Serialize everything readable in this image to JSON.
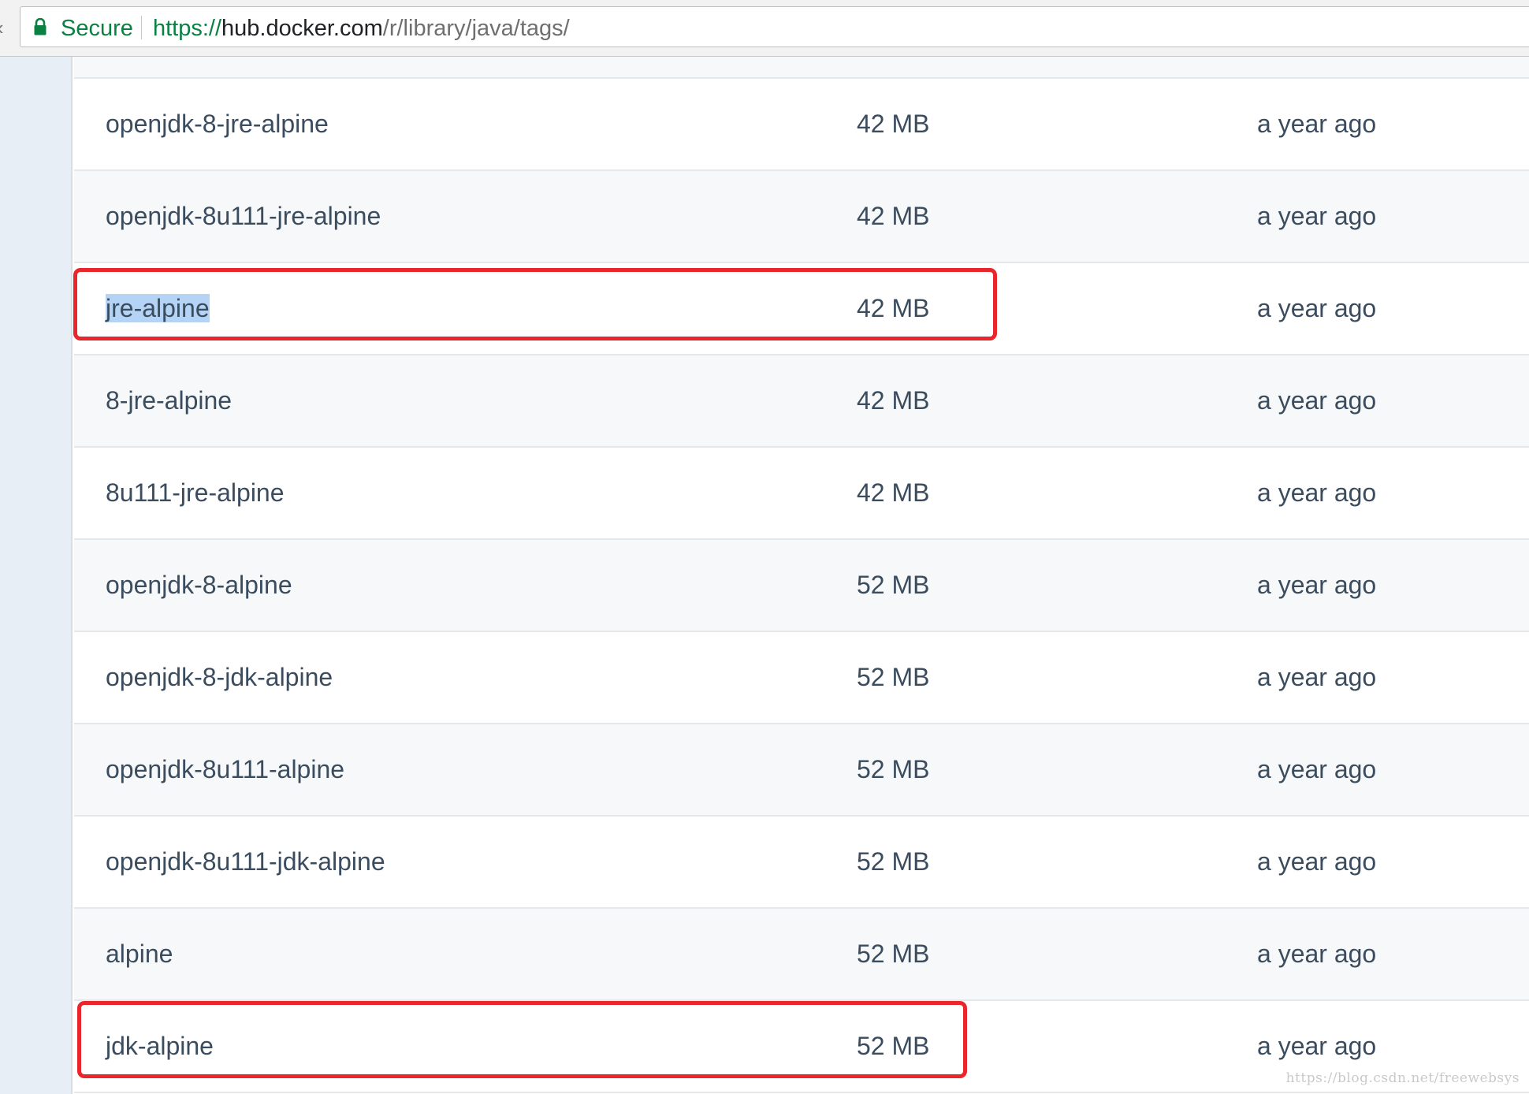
{
  "browser": {
    "secure_label": "Secure",
    "url_scheme": "https://",
    "url_host": "hub.docker.com",
    "url_path": "/r/library/java/tags/"
  },
  "tags": [
    {
      "name": "openjdk-8-jre-alpine",
      "size": "42 MB",
      "updated": "a year ago"
    },
    {
      "name": "openjdk-8u111-jre-alpine",
      "size": "42 MB",
      "updated": "a year ago"
    },
    {
      "name": "jre-alpine",
      "size": "42 MB",
      "updated": "a year ago"
    },
    {
      "name": "8-jre-alpine",
      "size": "42 MB",
      "updated": "a year ago"
    },
    {
      "name": "8u111-jre-alpine",
      "size": "42 MB",
      "updated": "a year ago"
    },
    {
      "name": "openjdk-8-alpine",
      "size": "52 MB",
      "updated": "a year ago"
    },
    {
      "name": "openjdk-8-jdk-alpine",
      "size": "52 MB",
      "updated": "a year ago"
    },
    {
      "name": "openjdk-8u111-alpine",
      "size": "52 MB",
      "updated": "a year ago"
    },
    {
      "name": "openjdk-8u111-jdk-alpine",
      "size": "52 MB",
      "updated": "a year ago"
    },
    {
      "name": "alpine",
      "size": "52 MB",
      "updated": "a year ago"
    },
    {
      "name": "jdk-alpine",
      "size": "52 MB",
      "updated": "a year ago"
    }
  ],
  "highlighted_tags": [
    "jre-alpine",
    "jdk-alpine"
  ],
  "selected_text": "jre-alpine",
  "colors": {
    "secure_green": "#0b8043",
    "annotation_red": "#e8262b",
    "selection_blue": "#b4d3f5",
    "row_text": "#3a4c5e"
  },
  "icons": {
    "lock": "lock-icon",
    "back": "back-arrow-icon"
  },
  "watermark": "https://blog.csdn.net/freewebsys"
}
